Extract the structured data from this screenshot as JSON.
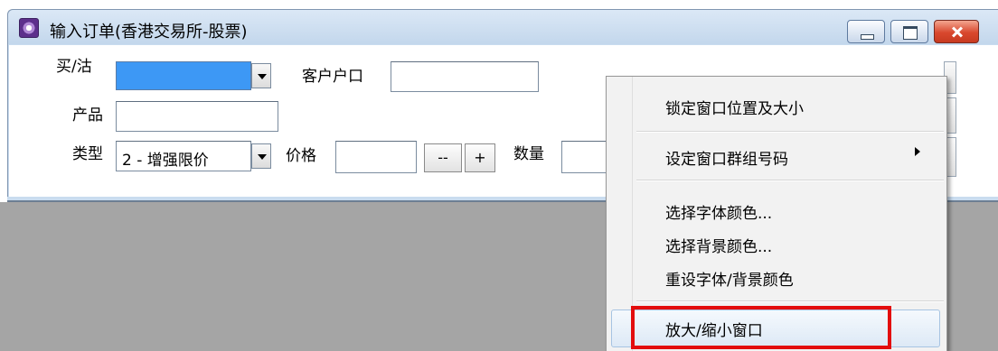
{
  "window": {
    "title": "输入订单(香港交易所-股票)",
    "buttons": [
      "minimize",
      "maximize",
      "close"
    ]
  },
  "form": {
    "buy_sell": {
      "label": "买/沽",
      "value": ""
    },
    "account": {
      "label": "客户户口",
      "value": ""
    },
    "product": {
      "label": "产品",
      "value": ""
    },
    "type": {
      "label": "类型",
      "value": "2 - 增强限价"
    },
    "price": {
      "label": "价格",
      "value": "",
      "decrement_label": "--",
      "increment_label": "+"
    },
    "quantity": {
      "label": "数量",
      "value": ""
    }
  },
  "context_menu": {
    "items": [
      {
        "label": "锁定窗口位置及大小"
      },
      {
        "label": "设定窗口群组号码",
        "has_submenu": true
      },
      {
        "label": "选择字体颜色..."
      },
      {
        "label": "选择背景颜色..."
      },
      {
        "label": "重设字体/背景颜色"
      },
      {
        "label": "放大/缩小窗口",
        "hovered": true,
        "highlighted": true
      }
    ]
  },
  "colors": {
    "title_bar": "#c9dcef",
    "selection_blue": "#3d98f5",
    "workspace": "#a5a5a5",
    "highlight_box": "#e30d0d",
    "close_button": "#d9482e"
  }
}
